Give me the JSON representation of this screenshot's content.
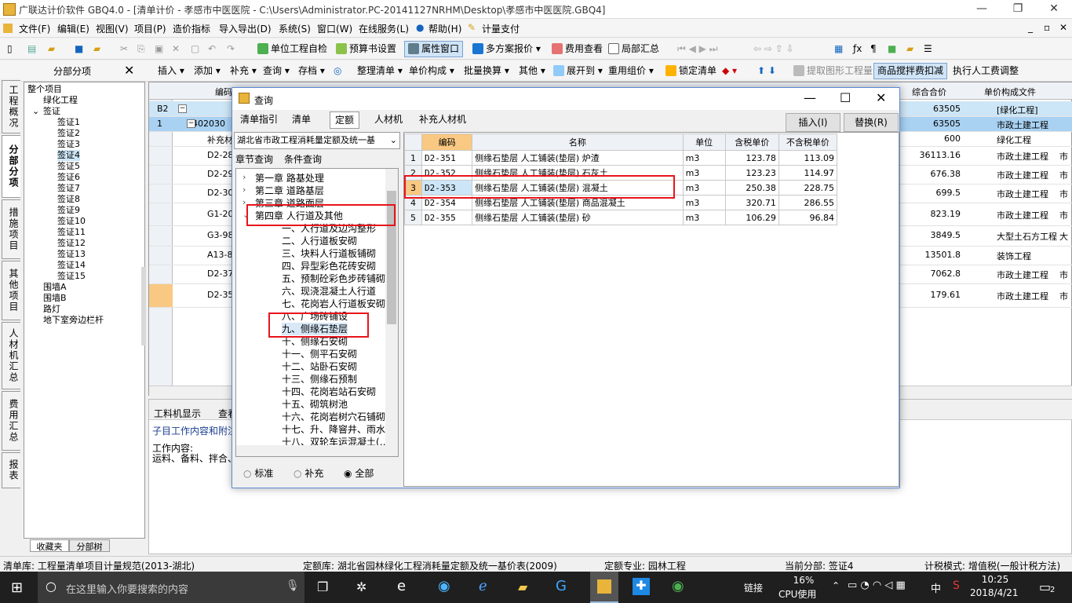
{
  "window": {
    "title": "广联达计价软件 GBQ4.0 - [清单计价 - 孝感市中医医院 - C:\\Users\\Administrator.PC-20141127NRHM\\Desktop\\孝感市中医医院.GBQ4]"
  },
  "menu": [
    "文件(F)",
    "编辑(E)",
    "视图(V)",
    "项目(P)",
    "造价指标",
    "导入导出(D)",
    "系统(S)",
    "窗口(W)",
    "在线服务(L)",
    "帮助(H)",
    "计量支付"
  ],
  "toolbar1": {
    "selfcheck": "单位工程自检",
    "budget": "预算书设置",
    "property": "属性窗口",
    "multi": "多方案报价",
    "cost": "费用查看",
    "partial": "局部汇总"
  },
  "toolbar2": {
    "panel_title": "分部分项",
    "items": [
      "插入",
      "添加",
      "补充",
      "查询",
      "存档",
      "整理清单",
      "单价构成",
      "批量换算",
      "其他",
      "展开到",
      "重用组价",
      "锁定清单",
      "提取图形工程量",
      "商品搅拌费扣减",
      "执行人工费调整"
    ]
  },
  "vtabs": [
    "工程概况",
    "分部分项",
    "措施项目",
    "其他项目",
    "人材机汇总",
    "费用汇总",
    "报表"
  ],
  "tree": {
    "root": "整个项目",
    "items": [
      "绿化工程",
      "签证",
      "签证1",
      "签证2",
      "签证3",
      "签证4",
      "签证5",
      "签证6",
      "签证7",
      "签证8",
      "签证9",
      "签证10",
      "签证11",
      "签证12",
      "签证13",
      "签证14",
      "签证15",
      "围墙A",
      "围墙B",
      "路灯",
      "地下室旁边栏杆"
    ],
    "tabs": [
      "收藏夹",
      "分部树"
    ]
  },
  "grid": {
    "headers": [
      "编码",
      "综合合价",
      "单价构成文件"
    ],
    "rows": [
      {
        "no": "B2",
        "code": "",
        "total": "63505",
        "file": "[绿化工程]"
      },
      {
        "no": "1",
        "code": "0402030",
        "total": "63505",
        "file": "市政土建工程"
      },
      {
        "no": "",
        "code": "补充材",
        "total": "600",
        "file": "绿化工程"
      },
      {
        "no": "",
        "code": "D2-28",
        "total": "36113.16",
        "file": "市政土建工程",
        "extra": "市"
      },
      {
        "no": "",
        "code": "D2-29",
        "total": "676.38",
        "file": "市政土建工程",
        "extra": "市"
      },
      {
        "no": "",
        "code": "D2-30",
        "total": "699.5",
        "file": "市政土建工程",
        "extra": "市"
      },
      {
        "no": "",
        "code": "G1-20",
        "total": "823.19",
        "file": "市政土建工程",
        "extra": "市"
      },
      {
        "no": "",
        "code": "G3-98",
        "total": "3849.5",
        "file": "大型土石方工程",
        "extra": "大"
      },
      {
        "no": "",
        "code": "A13-8",
        "total": "13501.8",
        "file": "装饰工程"
      },
      {
        "no": "",
        "code": "D2-37",
        "total": "7062.8",
        "file": "市政土建工程",
        "extra": "市"
      },
      {
        "no": "",
        "code": "D2-35",
        "total": "179.61",
        "file": "市政土建工程",
        "extra": "市"
      }
    ]
  },
  "bottom": {
    "tabs": [
      "工料机显示",
      "查看"
    ],
    "subtitle": "子目工作内容和附注",
    "work": "工作内容:",
    "work_detail": "运料、备料、拌合、..."
  },
  "dialog": {
    "title": "查询",
    "tabs": [
      "清单指引",
      "清单",
      "定额",
      "人材机",
      "补充人材机"
    ],
    "insert": "插入(I)",
    "replace": "替换(R)",
    "library": "湖北省市政工程消耗量定额及统一基",
    "subtabs": [
      "章节查询",
      "条件查询"
    ],
    "tree": [
      "第一章 路基处理",
      "第二章  道路基层",
      "第三章 道路面层",
      "第四章 人行道及其他",
      "一、人行道及边沟整形",
      "二、人行道板安砌",
      "三、块料人行道板铺砌",
      "四、异型彩色花砖安砌",
      "五、预制砼彩色步砖铺砌",
      "六、现浇混凝土人行道",
      "七、花岗岩人行道板安砌",
      "八、广场砖铺设",
      "九、侧缘石垫层",
      "十、侧缘石安砌",
      "十一、侧平石安砌",
      "十二、站卧石安砌",
      "十三、侧缘石预制",
      "十四、花岗岩站石安砌",
      "十五、砌筑树池",
      "十六、花岗岩树穴石铺砌",
      "十七、升、降窨井、雨水",
      "十八、双轮车运混凝土(…"
    ],
    "radios": [
      "标准",
      "补充",
      "全部"
    ],
    "table": {
      "headers": [
        "编码",
        "名称",
        "单位",
        "含税单价",
        "不含税单价"
      ],
      "rows": [
        {
          "n": "1",
          "code": "D2-351",
          "name": "侧缘石垫层 人工铺装(垫层) 炉渣",
          "unit": "m3",
          "tax": "123.78",
          "notax": "113.09"
        },
        {
          "n": "2",
          "code": "D2-352",
          "name": "侧缘石垫层 人工铺装(垫层) 石灰土",
          "unit": "m3",
          "tax": "123.23",
          "notax": "114.97"
        },
        {
          "n": "3",
          "code": "D2-353",
          "name": "侧缘石垫层 人工铺装(垫层) 混凝土",
          "unit": "m3",
          "tax": "250.38",
          "notax": "228.75"
        },
        {
          "n": "4",
          "code": "D2-354",
          "name": "侧缘石垫层 人工铺装(垫层) 商品混凝土",
          "unit": "m3",
          "tax": "320.71",
          "notax": "286.55"
        },
        {
          "n": "5",
          "code": "D2-355",
          "name": "侧缘石垫层 人工铺装(垫层) 砂",
          "unit": "m3",
          "tax": "106.29",
          "notax": "96.84"
        }
      ]
    }
  },
  "status": {
    "list_lib": "清单库: 工程量清单项目计量规范(2013-湖北)",
    "quota_lib": "定额库: 湖北省园林绿化工程消耗量定额及统一基价表(2009)",
    "specialty": "定额专业: 园林工程",
    "current": "当前分部: 签证4",
    "tax": "计税模式: 增值税(一般计税方法)"
  },
  "taskbar": {
    "search": "在这里输入你要搜索的内容",
    "link": "链接",
    "cpu": "16%",
    "cpu_label": "CPU使用",
    "ime": "中",
    "time": "10:25",
    "date": "2018/4/21",
    "notif": "2"
  }
}
